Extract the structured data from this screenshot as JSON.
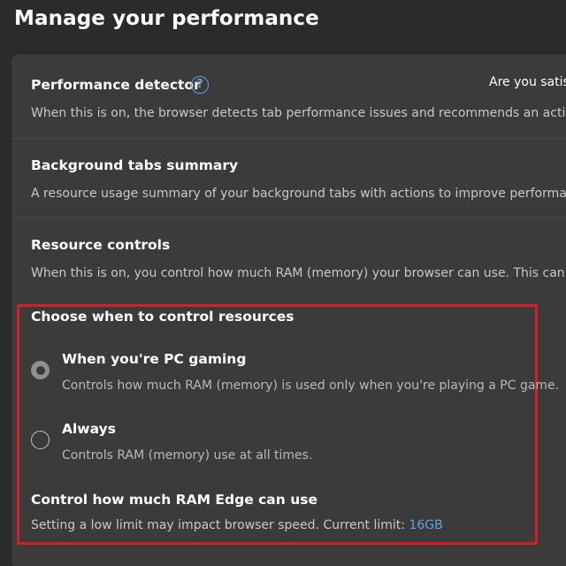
{
  "page_title": "Manage your performance",
  "performance_detector": {
    "title": "Performance detector",
    "help_icon": "help-icon",
    "help_glyph": "?",
    "desc": "When this is on, the browser detects tab performance issues and recommends an action to f",
    "feedback_text": "Are you satisf"
  },
  "background_tabs": {
    "title": "Background tabs summary",
    "desc": "A resource usage summary of your background tabs with actions to improve performance."
  },
  "resource_controls": {
    "title": "Resource controls",
    "desc": "When this is on, you control how much RAM (memory) your browser can use. This can impac"
  },
  "control_resources": {
    "heading": "Choose when to control resources",
    "options": [
      {
        "label": "When you're PC gaming",
        "desc": "Controls how much RAM (memory) is used only when you're playing a PC game.",
        "selected": true
      },
      {
        "label": "Always",
        "desc": "Controls RAM (memory) use at all times.",
        "selected": false
      }
    ],
    "ram_title": "Control how much RAM Edge can use",
    "ram_desc": "Setting a low limit may impact browser speed. Current limit: ",
    "ram_limit": "16GB"
  },
  "colors": {
    "background": "#2b2b2b",
    "card": "#3b3b3b",
    "accent": "#5ea0e0",
    "highlight": "#d41f26"
  }
}
